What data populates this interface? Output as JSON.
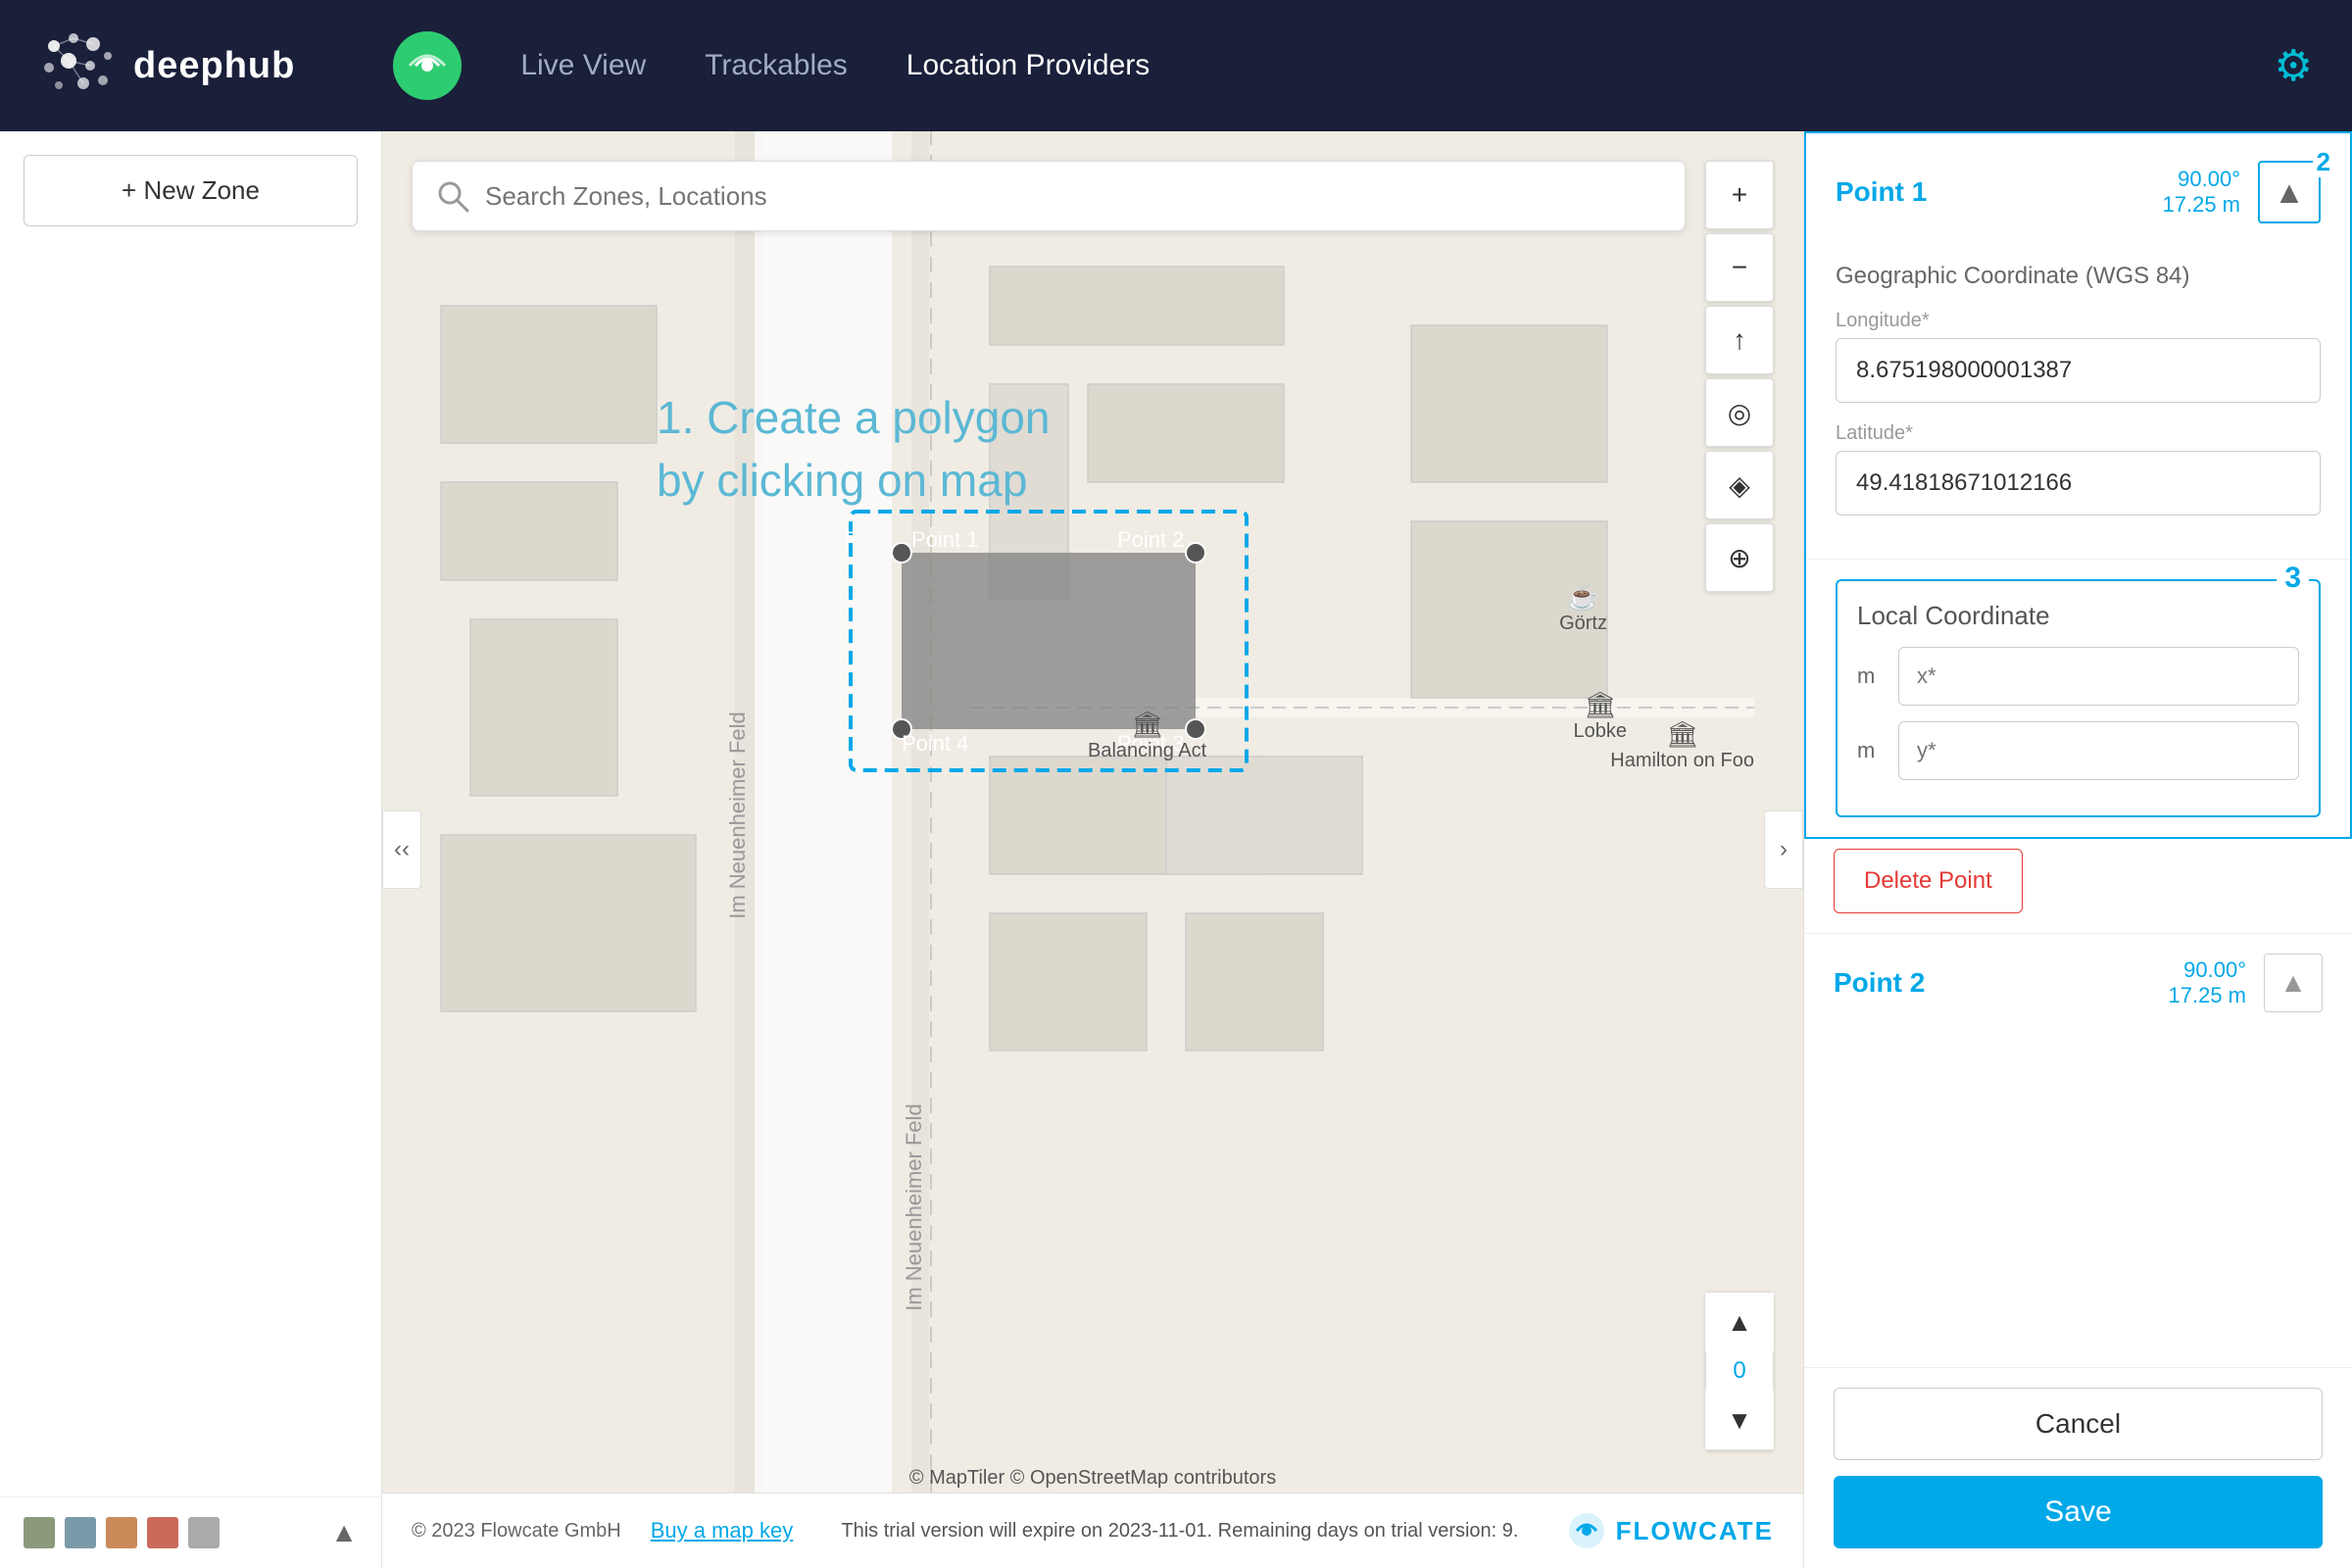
{
  "header": {
    "logo_text": "deephub",
    "nav_items": [
      {
        "label": "Live View",
        "active": false
      },
      {
        "label": "Trackables",
        "active": false
      },
      {
        "label": "Location Providers",
        "active": true
      }
    ],
    "settings_icon": "⚙"
  },
  "sidebar": {
    "new_zone_label": "+ New Zone",
    "colors": [
      "#8a9a7a",
      "#7a9aaa",
      "#ca8a5a",
      "#ca6a5a",
      "#aaaaaa"
    ],
    "collapse_icon": "▲"
  },
  "map": {
    "search_placeholder": "Search Zones, Locations",
    "instruction_line1": "1. Create a polygon",
    "instruction_line2": "by clicking on map",
    "polygon_points": [
      "Point 1",
      "Point 2",
      "Point 3",
      "Point 4"
    ],
    "map_labels": [
      "Görtz",
      "Balancing Act",
      "Lobke",
      "Hamilton on Foo"
    ],
    "attribution": "© MapTiler © OpenStreetMap contributors",
    "footer_copyright": "© 2023 Flowcate GmbH",
    "buy_map_key": "Buy a map key",
    "trial_notice": "This trial version will expire on 2023-11-01. Remaining days on trial version: 9.",
    "zoom_number": "0"
  },
  "right_panel": {
    "point1": {
      "title": "Point 1",
      "coords_line1": "90.00°",
      "coords_line2": "17.25 m",
      "active_number": "2",
      "icon": "▲"
    },
    "geo_coord": {
      "title": "Geographic Coordinate (WGS 84)",
      "longitude_label": "Longitude*",
      "longitude_value": "8.675198000001387",
      "latitude_label": "Latitude*",
      "latitude_value": "49.41818671012166"
    },
    "local_coord": {
      "title": "Local Coordinate",
      "section_number": "3",
      "x_unit": "m",
      "x_label": "x*",
      "y_unit": "m",
      "y_label": "y*"
    },
    "delete_btn": "Delete Point",
    "point2": {
      "title": "Point 2",
      "coords_line1": "90.00°",
      "coords_line2": "17.25 m",
      "icon": "▲"
    },
    "cancel_label": "Cancel",
    "save_label": "Save"
  }
}
